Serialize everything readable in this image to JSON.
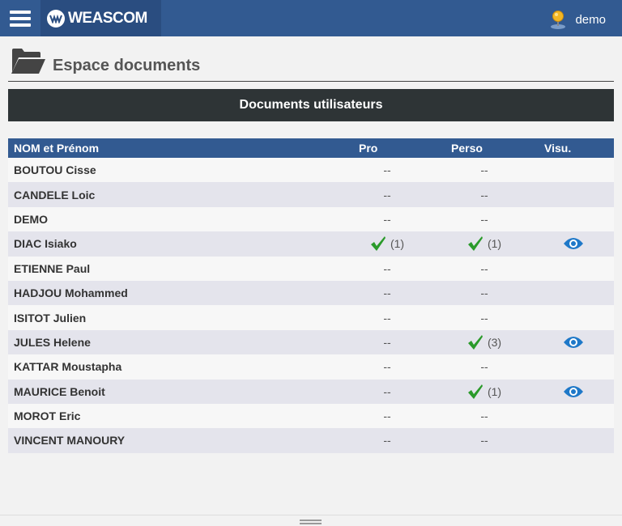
{
  "app": {
    "brand": "WEASCOM",
    "user": "demo"
  },
  "page": {
    "title": "Espace documents",
    "section_title": "Documents utilisateurs"
  },
  "table": {
    "headers": {
      "name": "NOM et Prénom",
      "pro": "Pro",
      "perso": "Perso",
      "visu": "Visu."
    },
    "rows": [
      {
        "name": "BOUTOU Cisse",
        "pro": "--",
        "perso": "--"
      },
      {
        "name": "CANDELE Loic",
        "pro": "--",
        "perso": "--"
      },
      {
        "name": "DEMO",
        "pro": "--",
        "perso": "--"
      },
      {
        "name": "DIAC Isiako",
        "pro": "(1)",
        "perso": "(1)"
      },
      {
        "name": "ETIENNE Paul",
        "pro": "--",
        "perso": "--"
      },
      {
        "name": "HADJOU Mohammed",
        "pro": "--",
        "perso": "--"
      },
      {
        "name": "ISITOT Julien",
        "pro": "--",
        "perso": "--"
      },
      {
        "name": "JULES Helene",
        "pro": "--",
        "perso": "(3)"
      },
      {
        "name": "KATTAR Moustapha",
        "pro": "--",
        "perso": "--"
      },
      {
        "name": "MAURICE Benoit",
        "pro": "--",
        "perso": "(1)"
      },
      {
        "name": "MOROT Eric",
        "pro": "--",
        "perso": "--"
      },
      {
        "name": "VINCENT MANOURY",
        "pro": "--",
        "perso": "--"
      }
    ]
  },
  "colors": {
    "topbar": "#325a91",
    "section": "#2e3436",
    "check": "#2a9a2a",
    "eye": "#1e78c8"
  },
  "icons": {
    "menu": "hamburger-icon",
    "user": "user-pin-icon",
    "page": "folder-open-icon",
    "check": "checkmark-icon",
    "view": "eye-icon"
  }
}
